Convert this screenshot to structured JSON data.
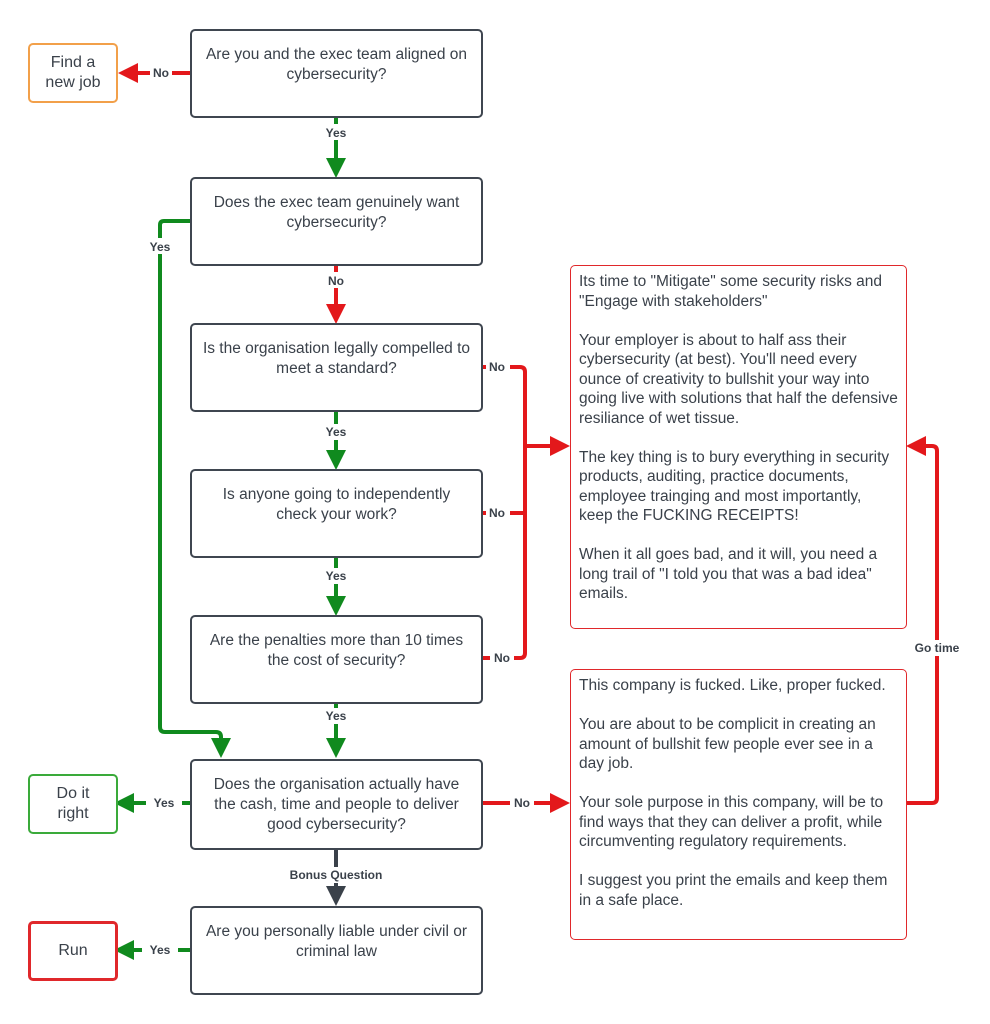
{
  "colors": {
    "yes": "#108a1e",
    "no": "#e3181b",
    "neutral": "#3a414a",
    "orange": "#f2a04a",
    "green_border": "#3aaa3a",
    "red_border": "#e0282b"
  },
  "questions": {
    "q1": "Are you and the exec team aligned on cybersecurity?",
    "q2": "Does the exec team genuinely want cybersecurity?",
    "q3": "Is the organisation legally compelled to meet a standard?",
    "q4": "Is anyone going to independently check your work?",
    "q5": "Are the penalties more than 10 times the cost of security?",
    "q6": "Does the organisation actually have the cash, time and people to deliver good cybersecurity?",
    "q7": "Are you personally liable under civil or criminal law"
  },
  "outcomes": {
    "find_job": "Find a new job",
    "do_it_right": "Do it right",
    "run": "Run"
  },
  "notes": {
    "mitigate": "Its time to \"Mitigate\" some security risks and \"Engage with stakeholders\"\n\nYour employer is about to half ass their cybersecurity (at best). You'll need every ounce of creativity to bullshit your way into going live with solutions that half the defensive resiliance of wet tissue.\n\nThe key thing is to bury everything in security products, auditing, practice documents, employee trainging and most importantly, keep the FUCKING RECEIPTS!\n\nWhen it all goes bad, and it will, you need a long trail of \"I told you that was a bad idea\" emails.",
    "fucked": "This company is fucked. Like, proper fucked.\n\nYou are about to be complicit in creating an amount of bullshit few people ever see in a day job.\n\nYour sole purpose in this company, will be to find ways that they can deliver a profit, while circumventing regulatory requirements.\n\nI suggest you print the emails and keep them in a safe place."
  },
  "edge_labels": {
    "yes": "Yes",
    "no": "No",
    "bonus": "Bonus Question",
    "go_time": "Go time"
  }
}
